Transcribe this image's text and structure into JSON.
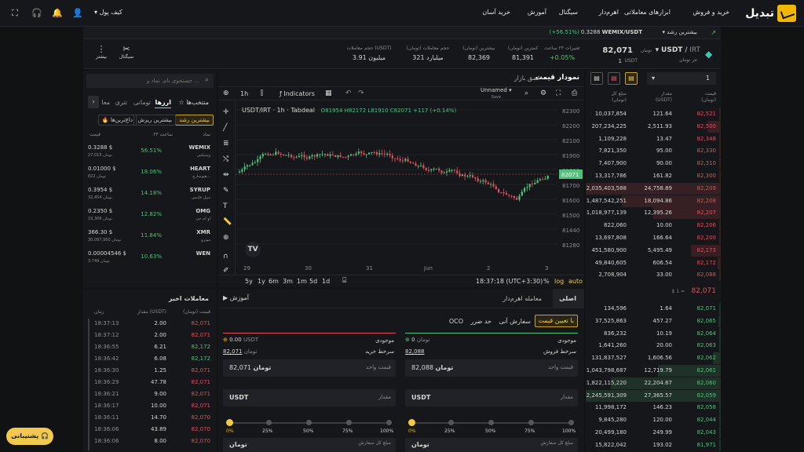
{
  "nav": {
    "brand": "تبدیل",
    "items": [
      "خرید و فروش",
      "ابزارهای معاملاتی",
      "اهرم‌دار",
      "سیگنال",
      "آموزش",
      "خرید آسان"
    ],
    "wallet": "کیف پول"
  },
  "marketbar": {
    "sort": "بیشترین رشد",
    "pair": "WEMIX/USDT",
    "price": "0.3288",
    "change": "(+56.51%)"
  },
  "ticker": {
    "pair": "USDT",
    "quote": "IRT",
    "pair_sep": "/",
    "name": "تتر تومان",
    "price": "82,071",
    "unit": "تومان",
    "usdt_price": "1",
    "usdt_unit": "USDT",
    "stats": [
      {
        "label": "تغییرات ۲۴ ساعت",
        "value": "+0.05%"
      },
      {
        "label": "کمترین (تومان)",
        "value": "81,391"
      },
      {
        "label": "بیشترین (تومان)",
        "value": "82,369"
      },
      {
        "label": "حجم معاملات (تومان)",
        "value": "321 میلیارد"
      },
      {
        "label": "حجم معاملات (USDT)",
        "value": "3.91 میلیون"
      }
    ],
    "signal": "سیگنال",
    "more": "بیشتر"
  },
  "market": {
    "search_placeholder": "جستجوی نام، نماد و ...",
    "tabs": [
      "منتخب‌ها",
      "ارزها",
      "تومانی",
      "تتری",
      "معا"
    ],
    "chips": [
      "بیشترین رشد",
      "بیشترین ریزش",
      "داغ‌ترین‌ها"
    ],
    "headers": [
      "نماد",
      "۲۴ ساعت",
      "قیمت"
    ],
    "rows": [
      {
        "sym": "WEMIX",
        "name": "ویمیکس",
        "chg": "56.51%",
        "p1": "0.3288 $",
        "p2": "27,015 تومان"
      },
      {
        "sym": "HEART",
        "name": "هیومنارچ...",
        "chg": "18.06%",
        "p1": "0.01000 $",
        "p2": "822 تومان"
      },
      {
        "sym": "SYRUP",
        "name": "میپل فاینس",
        "chg": "14.18%",
        "p1": "0.3954 $",
        "p2": "32,454 تومان"
      },
      {
        "sym": "OMG",
        "name": "او ام جی",
        "chg": "12.82%",
        "p1": "0.2350 $",
        "p2": "19,306 تومان"
      },
      {
        "sym": "XMR",
        "name": "مونرو",
        "chg": "11.84%",
        "p1": "366.30 $",
        "p2": "30,097,950 تومان"
      },
      {
        "sym": "WEN",
        "name": "",
        "chg": "10.63%",
        "p1": "0.00004546 $",
        "p2": "3.749 تومان"
      }
    ]
  },
  "trades": {
    "title": "معاملات اخیر",
    "headers": [
      "قیمت (تومان)",
      "مقدار (USDT)",
      "زمان"
    ],
    "rows": [
      [
        "82,071",
        "2.00",
        "18:37:13",
        "r"
      ],
      [
        "82,071",
        "2.00",
        "18:37:12",
        "r"
      ],
      [
        "82,172",
        "6.21",
        "18:36:55",
        "g"
      ],
      [
        "82,172",
        "6.08",
        "18:36:42",
        "g"
      ],
      [
        "82,071",
        "1.25",
        "18:36:30",
        "r"
      ],
      [
        "82,071",
        "47.78",
        "18:36:29",
        "r"
      ],
      [
        "82,071",
        "9.00",
        "18:36:21",
        "r"
      ],
      [
        "82,071",
        "10.00",
        "18:36:17",
        "r"
      ],
      [
        "82,070",
        "14.70",
        "18:36:11",
        "r"
      ],
      [
        "82,070",
        "43.89",
        "18:36:06",
        "r"
      ],
      [
        "82,070",
        "8.00",
        "18:36:06",
        "r"
      ]
    ]
  },
  "chart": {
    "tabs": [
      "نمودار قیمت",
      "عمق بازار"
    ],
    "interval": "1h",
    "indicators": "Indicators",
    "layout": "Unnamed",
    "layout_sub": "Save",
    "legend": "USDT/IRT · 1h · Tabdeal",
    "ohlc": "O81954 H82172 L81910 C82071 +117 (+0.14%)",
    "yticks": [
      "82300",
      "82200",
      "82100",
      "81900",
      "81800",
      "81700",
      "81600",
      "81500",
      "81440",
      "81280"
    ],
    "current": "82071",
    "xticks": [
      "29",
      "30",
      "31",
      "Jun",
      "2",
      "3"
    ],
    "ranges": [
      "5y",
      "1y",
      "6m",
      "3m",
      "1m",
      "5d",
      "1d"
    ],
    "time": "18:37:18 (UTC+3:30)",
    "opts": [
      "%",
      "log",
      "auto"
    ]
  },
  "orderbook": {
    "amount": "1",
    "headers": [
      "قیمت (تومان)",
      "مقدار (USDT)",
      "مبلغ کل (تومان)"
    ],
    "asks": [
      [
        "82,521",
        "121.64",
        "10,037,854"
      ],
      [
        "82,500",
        "2,511.93",
        "207,234,225"
      ],
      [
        "82,348",
        "13.47",
        "1,109,228"
      ],
      [
        "82,330",
        "95.00",
        "7,821,350"
      ],
      [
        "82,310",
        "90.00",
        "7,407,900"
      ],
      [
        "82,300",
        "161.82",
        "13,317,786"
      ],
      [
        "82,209",
        "24,758.89",
        "2,035,403,588"
      ],
      [
        "82,208",
        "18,094.86",
        "1,487,542,251"
      ],
      [
        "82,207",
        "12,395.26",
        "1,018,977,139"
      ],
      [
        "82,206",
        "10.00",
        "822,060"
      ],
      [
        "82,200",
        "166.64",
        "13,697,808"
      ],
      [
        "82,173",
        "5,495.49",
        "451,580,900"
      ],
      [
        "82,172",
        "606.54",
        "49,840,605"
      ],
      [
        "82,088",
        "33.00",
        "2,708,904"
      ]
    ],
    "mid": "82,071",
    "mid_sub": "$ 1 =",
    "bids": [
      [
        "82,071",
        "1.64",
        "134,596"
      ],
      [
        "82,065",
        "457.27",
        "37,525,863"
      ],
      [
        "82,064",
        "10.19",
        "836,232"
      ],
      [
        "82,063",
        "20.00",
        "1,641,260"
      ],
      [
        "82,062",
        "1,606.56",
        "131,837,527"
      ],
      [
        "82,061",
        "12,719.79",
        "1,043,798,687"
      ],
      [
        "82,060",
        "22,204.67",
        "1,822,115,220"
      ],
      [
        "82,059",
        "27,365.57",
        "2,245,591,309"
      ],
      [
        "82,058",
        "146.23",
        "11,998,172"
      ],
      [
        "82,044",
        "120.00",
        "9,845,280"
      ],
      [
        "82,043",
        "249.99",
        "20,499,180"
      ],
      [
        "81,971",
        "193.02",
        "15,822,042"
      ]
    ]
  },
  "order": {
    "tabs": [
      "اصلی",
      "معامله اهرم‌دار"
    ],
    "learn": "آموزش",
    "types": [
      "با تعیین قیمت",
      "سفارش آنی",
      "حد ضرر",
      "OCO"
    ],
    "buy": {
      "balance_label": "موجودی",
      "balance": "0",
      "balance_unit": "تومان",
      "ceiling_label": "سرخط فروش",
      "ceiling": "82,088",
      "price_label": "قیمت واحد",
      "price": "82,088",
      "unit": "تومان",
      "amount_label": "مقدار",
      "amount_unit": "USDT",
      "total_label": "مبلغ کل سفارش",
      "total_unit": "تومان"
    },
    "sell": {
      "balance_label": "موجودی",
      "balance": "0.00",
      "balance_unit": "USDT",
      "ceiling_label": "سرخط خرید",
      "ceiling": "82,071",
      "ceiling_unit": "تومان",
      "price_label": "قیمت واحد",
      "price": "82,071",
      "unit": "تومان",
      "amount_label": "مقدار",
      "amount_unit": "USDT",
      "total_label": "مبلغ کل سفارش",
      "total_unit": "تومان"
    },
    "percents": [
      "0%",
      "25%",
      "50%",
      "75%",
      "100%"
    ]
  },
  "support": "پشتیبانی",
  "colors": {
    "accent": "#f2b705",
    "green": "#4fc37a",
    "red": "#e0505a"
  }
}
